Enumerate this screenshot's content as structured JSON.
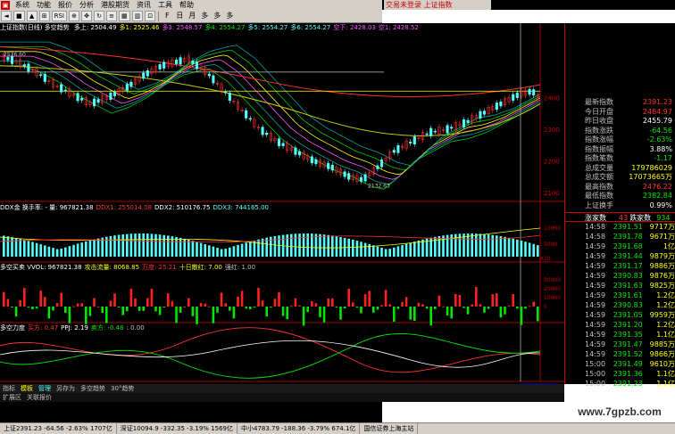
{
  "menu": {
    "items": [
      "系统",
      "功能",
      "报价",
      "分析",
      "港股期货",
      "资讯",
      "工具",
      "帮助"
    ],
    "login_status": "交易未登录  上证指数"
  },
  "toolbar": {
    "buttons": [
      "◄",
      "■",
      "▲",
      "⊞",
      "RSI",
      "⊕",
      "✥",
      "↻",
      "≡",
      "▦",
      "▥",
      "⊡"
    ],
    "periods": [
      "F",
      "日",
      "月",
      "多",
      "多",
      "多"
    ]
  },
  "main_panel": {
    "title": "上证指数(日线) 多空趋势",
    "ma_items": [
      {
        "label": "多上: 2504.49",
        "color": "#ffffff"
      },
      {
        "label": "多1: 2525.46",
        "color": "#ffff00"
      },
      {
        "label": "多3: 2548.57",
        "color": "#ff54ff"
      },
      {
        "label": "多4: 2554.27",
        "color": "#00e600"
      },
      {
        "label": "多5: 2554.27",
        "color": "#54ffff"
      },
      {
        "label": "多6: 2554.27",
        "color": "#54ffff"
      },
      {
        "label": "空下: 2428.03",
        "color": "#ff54ff"
      },
      {
        "label": "空1: 2428.52",
        "color": "#ff54ff"
      }
    ],
    "price_axis": [
      "2400",
      "2300",
      "2200",
      "2100"
    ],
    "high_label": "2536.60",
    "low_label": "2132.63"
  },
  "ddx_panel": {
    "items": [
      {
        "label": "DDX金  换手率: - 量: 967821.38",
        "color": "#ffffff"
      },
      {
        "label": "DDX1: 255014.08",
        "color": "#ff3232"
      },
      {
        "label": "DDX2: 510176.75",
        "color": "#ffffff"
      },
      {
        "label": "DDX3: 744165.00",
        "color": "#54ffff"
      }
    ],
    "axis": [
      "10000",
      "5000"
    ],
    "unit": "X10"
  },
  "vol_panel": {
    "items": [
      {
        "label": "多空买卖  VVOL: 967821.38",
        "color": "#ffffff"
      },
      {
        "label": "攻击流量: 8068.85",
        "color": "#ffff00"
      },
      {
        "label": "万度: 25.21",
        "color": "#ff3232"
      },
      {
        "label": "十日散红: 7.00",
        "color": "#ffff00"
      },
      {
        "label": "强红: 1.00",
        "color": "#c0c0c0"
      }
    ],
    "axis": [
      "30000",
      "20000",
      "10000",
      "0"
    ]
  },
  "force_panel": {
    "items": [
      {
        "label": "多空力度",
        "color": "#ffffff"
      },
      {
        "label": "买方: 0.47",
        "color": "#ff3232"
      },
      {
        "label": "PPJ: 2.19",
        "color": "#ffffff"
      },
      {
        "label": "卖方: -0.48",
        "color": "#00e600"
      },
      {
        "label": ": 0.00",
        "color": "#c0c0c0"
      }
    ]
  },
  "time_axis": {
    "labels": [
      "2011年",
      "10",
      "11",
      "12",
      "1",
      "2",
      "3"
    ],
    "cursor_date": "2012/03/06/二"
  },
  "quote": {
    "rows": [
      {
        "k": "最新指数",
        "v": "2391.23",
        "c": "#ff3232"
      },
      {
        "k": "今日开盘",
        "v": "2464.97",
        "c": "#ff3232"
      },
      {
        "k": "昨日收盘",
        "v": "2455.79",
        "c": "#ffffff"
      },
      {
        "k": "指数涨跌",
        "v": "-64.56",
        "c": "#00e600"
      },
      {
        "k": "指数涨幅",
        "v": "-2.63%",
        "c": "#00e600"
      },
      {
        "k": "指数振幅",
        "v": "3.88%",
        "c": "#ffffff"
      },
      {
        "k": "指数笔数",
        "v": "-1.17",
        "c": "#00e600"
      },
      {
        "k": "总成交量",
        "v": "179786029",
        "c": "#ffff00"
      },
      {
        "k": "总成交额",
        "v": "17073665万",
        "c": "#ffff00"
      },
      {
        "k": "最高指数",
        "v": "2476.22",
        "c": "#ff3232"
      },
      {
        "k": "最低指数",
        "v": "2382.84",
        "c": "#00e600"
      },
      {
        "k": "上证换手",
        "v": "0.99%",
        "c": "#ffffff"
      }
    ],
    "rise_label": "涨家数",
    "rise_count": "43",
    "fall_label": "跌家数",
    "fall_count": "934",
    "ticks": [
      {
        "t": "14:58",
        "p": "2391.51",
        "v": "9717万"
      },
      {
        "t": "14:58",
        "p": "2391.78",
        "v": "9671万"
      },
      {
        "t": "14:59",
        "p": "2391.68",
        "v": "1亿"
      },
      {
        "t": "14:59",
        "p": "2391.44",
        "v": "9879万"
      },
      {
        "t": "14:59",
        "p": "2391.17",
        "v": "9886万"
      },
      {
        "t": "14:59",
        "p": "2390.83",
        "v": "9876万"
      },
      {
        "t": "14:59",
        "p": "2391.63",
        "v": "9825万"
      },
      {
        "t": "14:59",
        "p": "2391.61",
        "v": "1.2亿"
      },
      {
        "t": "14:59",
        "p": "2390.83",
        "v": "1.2亿"
      },
      {
        "t": "14:59",
        "p": "2391.05",
        "v": "9959万"
      },
      {
        "t": "14:59",
        "p": "2391.20",
        "v": "1.2亿"
      },
      {
        "t": "14:59",
        "p": "2391.35",
        "v": "1.1亿"
      },
      {
        "t": "14:59",
        "p": "2391.47",
        "v": "9885万"
      },
      {
        "t": "14:59",
        "p": "2391.52",
        "v": "9866万"
      },
      {
        "t": "15:00",
        "p": "2391.49",
        "v": "9610万"
      },
      {
        "t": "15:00",
        "p": "2391.36",
        "v": "1.1亿"
      },
      {
        "t": "15:00",
        "p": "2391.23",
        "v": "1.1亿"
      }
    ],
    "bottom_tabs": [
      "日线",
      "周"
    ]
  },
  "bottom_tabs": [
    "指标",
    "模板",
    "管理",
    "另存为",
    "多空趋势",
    "30°趋势"
  ],
  "ext_bar": [
    "扩展区",
    "关联报价"
  ],
  "status": [
    {
      "text": "上证2391.23 -64.56 -2.63% 1707亿",
      "c": "#000"
    },
    {
      "text": "深证10094.9 -332.35 -3.19% 1569亿",
      "c": "#000"
    },
    {
      "text": "中小4783.79 -188.36 -3.79% 674.1亿",
      "c": "#000"
    },
    {
      "text": "国信证券上海主站",
      "c": "#000"
    }
  ],
  "watermark": "www.7gpzb.com"
}
